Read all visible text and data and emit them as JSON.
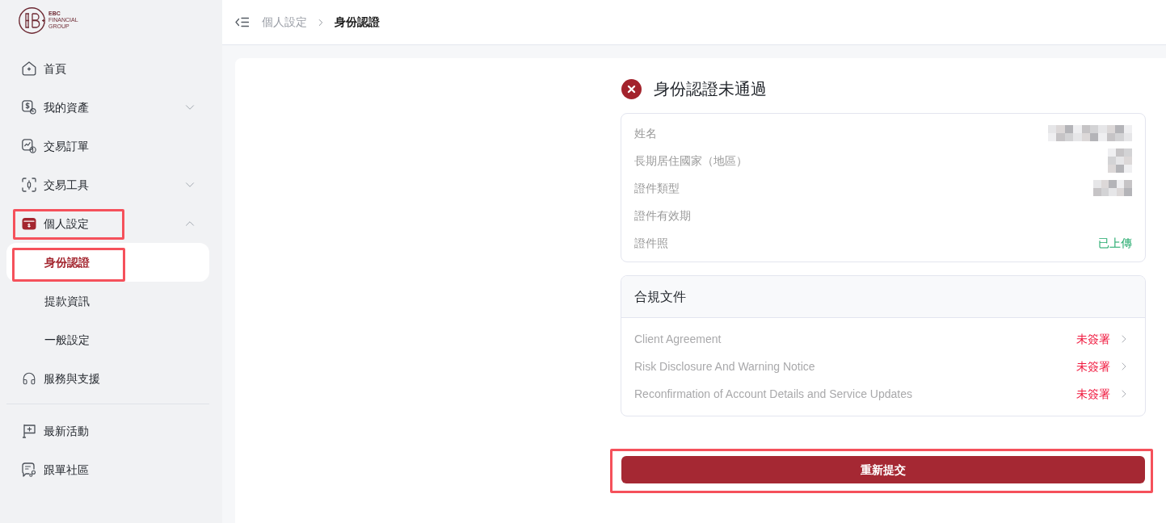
{
  "logo": {
    "lines": [
      "EBC",
      "FINANCIAL",
      "GROUP"
    ]
  },
  "nav": [
    {
      "label": "首頁",
      "kind": "link",
      "active": false,
      "highlighted": false
    },
    {
      "label": "我的資產",
      "kind": "group",
      "active": false,
      "highlighted": false,
      "expanded": false
    },
    {
      "label": "交易訂單",
      "kind": "link",
      "active": false,
      "highlighted": false
    },
    {
      "label": "交易工具",
      "kind": "group",
      "active": false,
      "highlighted": false,
      "expanded": false
    },
    {
      "label": "個人設定",
      "kind": "group",
      "active": true,
      "highlighted": true,
      "expanded": true,
      "children": [
        {
          "label": "身份認證",
          "selected": true,
          "highlighted": true
        },
        {
          "label": "提款資訊",
          "selected": false,
          "highlighted": false
        },
        {
          "label": "一般設定",
          "selected": false,
          "highlighted": false
        }
      ]
    },
    {
      "label": "服務與支援",
      "kind": "link",
      "active": false,
      "highlighted": false
    }
  ],
  "nav_secondary": [
    {
      "label": "最新活動",
      "active": false,
      "highlighted": false
    },
    {
      "label": "跟單社區",
      "active": false,
      "highlighted": false
    }
  ],
  "breadcrumb": [
    {
      "label": "個人設定",
      "current": false
    },
    {
      "label": "身份認證",
      "current": true
    }
  ],
  "status": {
    "kind": "failed",
    "title": "身份認證未通過"
  },
  "identity_fields": [
    {
      "label": "姓名",
      "kind": "redacted"
    },
    {
      "label": "長期居住國家（地區）",
      "kind": "redacted"
    },
    {
      "label": "證件類型",
      "kind": "redacted"
    },
    {
      "label": "證件有效期",
      "kind": "blank"
    },
    {
      "label": "證件照",
      "kind": "status",
      "value": "已上傳"
    }
  ],
  "compliance": {
    "title": "合規文件",
    "documents": [
      {
        "name": "Client Agreement",
        "status": "未簽署",
        "signed": false
      },
      {
        "name": "Risk Disclosure And Warning Notice",
        "status": "未簽署",
        "signed": false
      },
      {
        "name": "Reconfirmation of Account Details and Service Updates",
        "status": "未簽署",
        "signed": false
      }
    ]
  },
  "submit_button": {
    "label": "重新提交",
    "highlighted": true
  }
}
